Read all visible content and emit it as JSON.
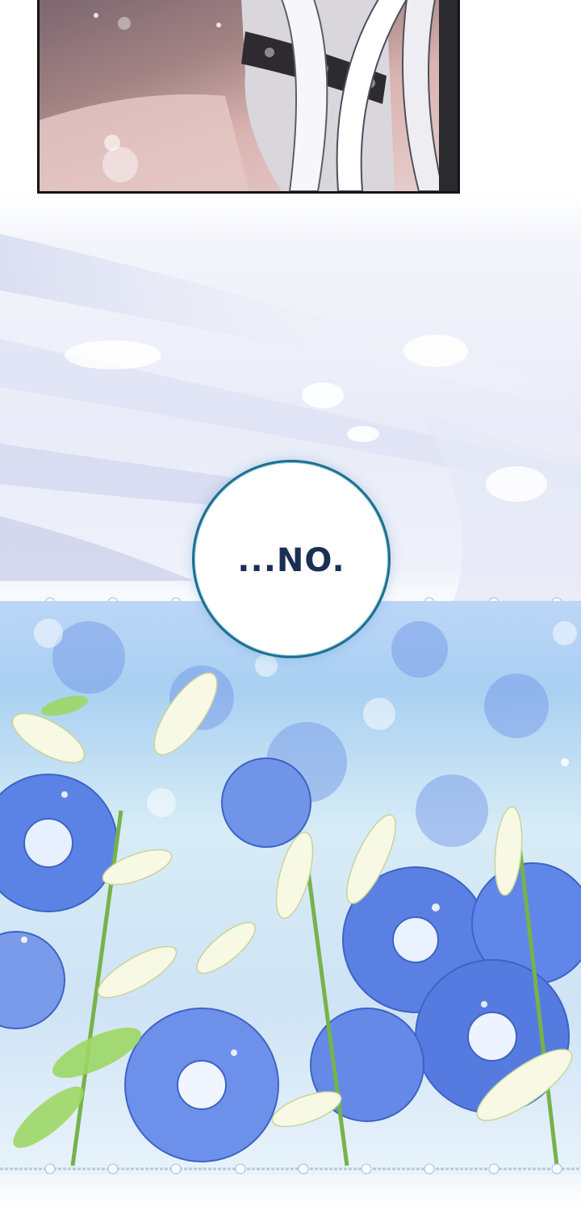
{
  "dialogue": {
    "speech_bubble_text": "...NO."
  },
  "palette": {
    "panel_border": "#151515",
    "bubble_border": "#1f6f8f",
    "bubble_text": "#1b2f55",
    "flower_blue": "#4f78e0",
    "flower_white": "#f4f7df",
    "leaf_green": "#8fd35a"
  }
}
